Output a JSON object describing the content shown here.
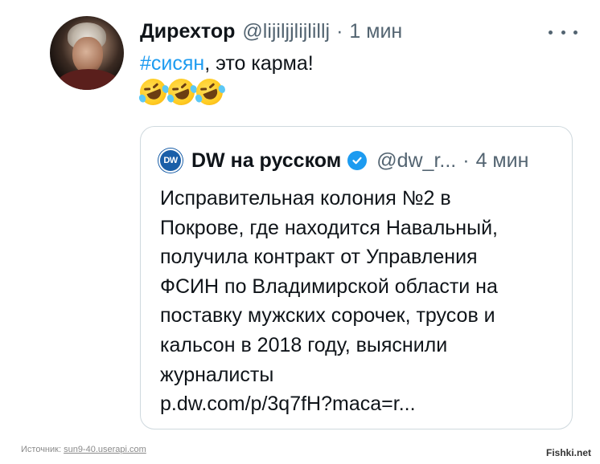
{
  "tweet": {
    "author": {
      "display_name": "Дирехтор",
      "handle": "@lijiljjlijlillj",
      "separator": "·",
      "time": "1 мин"
    },
    "more_icon": "more-horizontal-icon",
    "text": {
      "hashtag": "#сисян",
      "rest": ", это карма!"
    },
    "emoji_icon": "rolling-on-the-floor-laughing-emoji"
  },
  "quoted_tweet": {
    "author": {
      "avatar_text": "DW",
      "display_name": "DW на русском",
      "verified_icon": "verified-badge-icon",
      "handle": "@dw_r...",
      "separator": "·",
      "time": "4 мин"
    },
    "lines": [
      "Исправительная колония №2 в",
      "Покрове, где находится Навальный,",
      "получила контракт от Управления",
      "ФСИН по Владимирской области на",
      "поставку мужских сорочек, трусов и",
      "кальсон в 2018 году, выяснили",
      "журналисты",
      "p.dw.com/p/3q7fH?maca=r..."
    ]
  },
  "footer": {
    "source_label": "Источник:",
    "source_link": "sun9-40.userapi.com",
    "watermark": "Fishki.net"
  },
  "colors": {
    "text": "#0f1419",
    "secondary": "#536471",
    "accent": "#1d9bf0",
    "border": "#cfd9de"
  }
}
